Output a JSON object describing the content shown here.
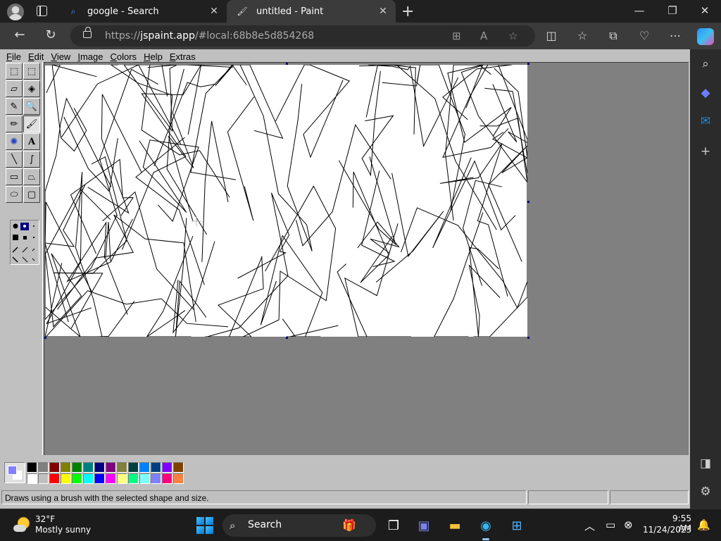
{
  "browser": {
    "tabs": [
      {
        "title": "google - Search",
        "close": "✕"
      },
      {
        "title": "untitled - Paint",
        "close": "✕"
      }
    ],
    "new_tab": "+",
    "window_controls": {
      "minimize": "—",
      "restore": "❐",
      "close": "✕"
    },
    "nav": {
      "back": "←",
      "refresh": "↻"
    },
    "url": {
      "prefix": "https://",
      "domain": "jspaint.app",
      "path": "/#local:68b8e5d854268"
    },
    "toolbar_icons": [
      "split-screen-icon",
      "favorites-icon",
      "collections-icon",
      "performance-icon",
      "more-icon"
    ]
  },
  "paint": {
    "menu": [
      "File",
      "Edit",
      "View",
      "Image",
      "Colors",
      "Help",
      "Extras"
    ],
    "tools": [
      {
        "name": "free-form-select",
        "glyph": "⬚"
      },
      {
        "name": "select",
        "glyph": "⬚"
      },
      {
        "name": "eraser",
        "glyph": "▱"
      },
      {
        "name": "fill-with-color",
        "glyph": "◈"
      },
      {
        "name": "pick-color",
        "glyph": "✎"
      },
      {
        "name": "magnifier",
        "glyph": "🔍"
      },
      {
        "name": "pencil",
        "glyph": "✏"
      },
      {
        "name": "brush",
        "glyph": "🖌"
      },
      {
        "name": "airbrush",
        "glyph": "✺"
      },
      {
        "name": "text",
        "glyph": "A"
      },
      {
        "name": "line",
        "glyph": "╲"
      },
      {
        "name": "curve",
        "glyph": "∫"
      },
      {
        "name": "rectangle",
        "glyph": "▭"
      },
      {
        "name": "polygon",
        "glyph": "⏢"
      },
      {
        "name": "ellipse",
        "glyph": "⬭"
      },
      {
        "name": "rounded-rectangle",
        "glyph": "▢"
      }
    ],
    "selected_tool": "brush",
    "primary_color": "#8080ff",
    "secondary_color": "#ffffff",
    "palette_top": [
      "#000000",
      "#808080",
      "#800000",
      "#808000",
      "#008000",
      "#008080",
      "#000080",
      "#800080",
      "#808040",
      "#004040",
      "#0080ff",
      "#004080",
      "#8000ff",
      "#804000"
    ],
    "palette_bottom": [
      "#ffffff",
      "#c0c0c0",
      "#ff0000",
      "#ffff00",
      "#00ff00",
      "#00ffff",
      "#0000ff",
      "#ff00ff",
      "#ffff80",
      "#00ff80",
      "#80ffff",
      "#8080ff",
      "#ff0080",
      "#ff8040"
    ],
    "status_text": "Draws using a brush with the selected shape and size."
  },
  "taskbar": {
    "weather_temp": "32°F",
    "weather_desc": "Mostly sunny",
    "search_label": "Search",
    "time": "9:55 AM",
    "date": "11/24/2023"
  }
}
